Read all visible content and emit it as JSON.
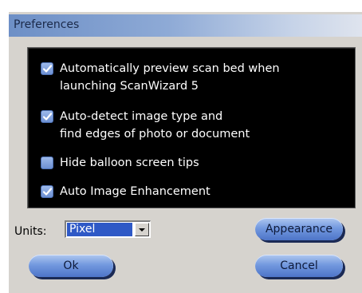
{
  "window": {
    "title": "Preferences"
  },
  "options": [
    {
      "lines": [
        "Automatically preview scan bed when",
        "launching ScanWizard 5"
      ],
      "checked": true
    },
    {
      "lines": [
        "Auto-detect image type and",
        "find edges of photo or document"
      ],
      "checked": true
    },
    {
      "lines": [
        "Hide balloon screen tips"
      ],
      "checked": false
    },
    {
      "lines": [
        "Auto Image Enhancement"
      ],
      "checked": true
    }
  ],
  "units": {
    "label": "Units:",
    "selected": "Pixel"
  },
  "buttons": {
    "appearance": "Appearance",
    "ok": "Ok",
    "cancel": "Cancel"
  },
  "colors": {
    "panel_bg": "#000000",
    "checkbox": "#7a9cdc",
    "button": "#6a8fd6"
  }
}
